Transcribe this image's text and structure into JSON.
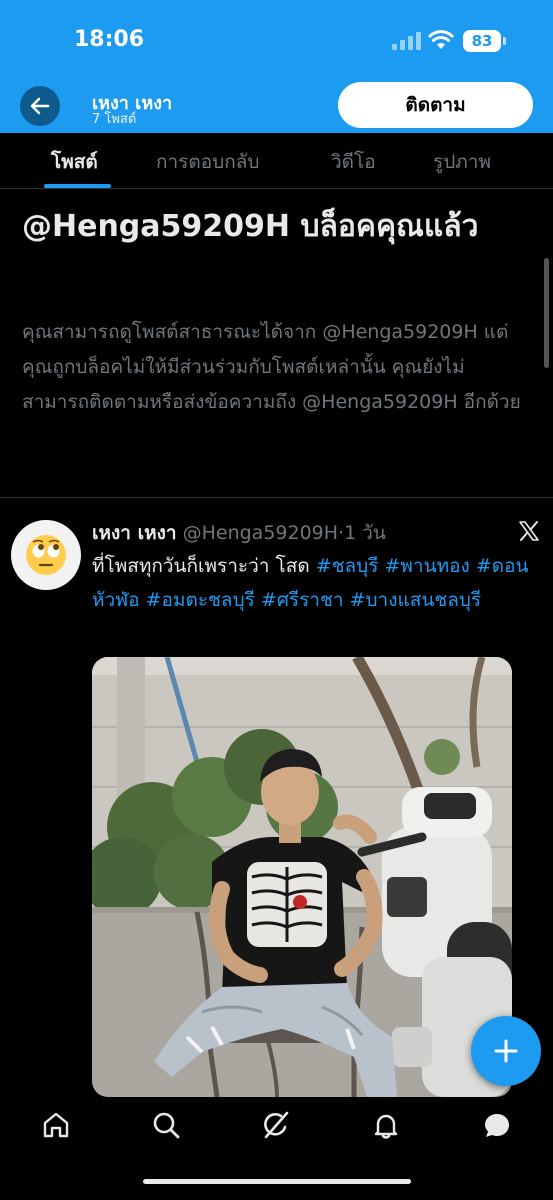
{
  "status_bar": {
    "time": "18:06",
    "battery": "83"
  },
  "header": {
    "name": "เหงา เหงา",
    "posts_count": "7 โพสต์",
    "follow_label": "ติดตาม"
  },
  "tabs": [
    {
      "label": "โพสต์"
    },
    {
      "label": "การตอบกลับ"
    },
    {
      "label": "วิดีโอ"
    },
    {
      "label": "รูปภาพ"
    }
  ],
  "blocked": {
    "title": "@Henga59209H บล็อคคุณแล้ว",
    "description": "คุณสามารถดูโพสต์สาธารณะได้จาก @Henga59209H แต่คุณถูกบล็อคไม่ให้มีส่วนร่วมกับโพสต์เหล่านั้น คุณยังไม่สามารถติดตามหรือส่งข้อความถึง @Henga59209H อีกด้วย"
  },
  "tweet": {
    "author_name": "เหงา เหงา",
    "author_handle": "@Henga59209H",
    "time": "1 วัน",
    "text_plain": "ที่โพสทุกวันก็เพราะว่า โสด",
    "hashtags": [
      "#ชลบุรี",
      "#พานทอง",
      "#ดอนหัวฬ่อ",
      "#อมตะชลบุรี",
      "#ศรีราชา",
      "#บางแสนชลบุรี"
    ]
  },
  "icons": {
    "back": "arrow-left-icon",
    "avatar": "eye-roll-emoji-icon",
    "source": "x-logo-icon",
    "fab": "plus-icon",
    "nav": [
      "home-icon",
      "search-icon",
      "grok-icon",
      "bell-icon",
      "messages-icon"
    ]
  },
  "colors": {
    "accent": "#1d9bf0",
    "background": "#000000",
    "muted": "#71767b"
  }
}
